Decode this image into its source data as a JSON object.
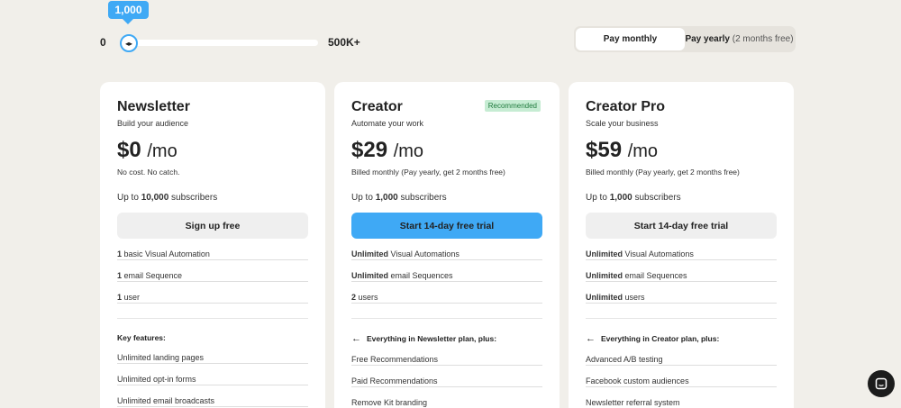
{
  "slider": {
    "tooltip": "1,000",
    "min_label": "0",
    "max_label": "500K+",
    "position_fraction": 0.0
  },
  "billing_toggle": {
    "monthly": "Pay monthly",
    "yearly": "Pay yearly",
    "yearly_note": "(2 months free)",
    "selected": "monthly"
  },
  "plans": [
    {
      "name": "Newsletter",
      "badge": "",
      "tagline": "Build your audience",
      "price": "$0",
      "per": "/mo",
      "note": "No cost. No catch.",
      "subs_prefix": "Up to ",
      "subs_count": "10,000",
      "subs_suffix": " subscribers",
      "cta": "Sign up free",
      "features": [
        {
          "bold": "1",
          "text": " basic Visual Automation"
        },
        {
          "bold": "1",
          "text": " email Sequence"
        },
        {
          "bold": "1",
          "text": " user"
        }
      ],
      "key_title": "Key features:",
      "key_features": [
        "Unlimited landing pages",
        "Unlimited opt-in forms",
        "Unlimited email broadcasts"
      ]
    },
    {
      "name": "Creator",
      "badge": "Recommended",
      "tagline": "Automate your work",
      "price": "$29",
      "per": "/mo",
      "note": "Billed monthly (Pay yearly, get 2 months free)",
      "subs_prefix": "Up to ",
      "subs_count": "1,000",
      "subs_suffix": " subscribers",
      "cta": "Start 14-day free trial",
      "features": [
        {
          "bold": "Unlimited",
          "text": " Visual Automations"
        },
        {
          "bold": "Unlimited",
          "text": " email Sequences"
        },
        {
          "bold": "2",
          "text": " users"
        }
      ],
      "key_title": "Everything in Newsletter plan, plus:",
      "key_features": [
        "Free Recommendations",
        "Paid Recommendations",
        "Remove Kit branding"
      ]
    },
    {
      "name": "Creator Pro",
      "badge": "",
      "tagline": "Scale your business",
      "price": "$59",
      "per": "/mo",
      "note": "Billed monthly (Pay yearly, get 2 months free)",
      "subs_prefix": "Up to ",
      "subs_count": "1,000",
      "subs_suffix": " subscribers",
      "cta": "Start 14-day free trial",
      "features": [
        {
          "bold": "Unlimited",
          "text": " Visual Automations"
        },
        {
          "bold": "Unlimited",
          "text": " email Sequences"
        },
        {
          "bold": "Unlimited",
          "text": " users"
        }
      ],
      "key_title": "Everything in Creator plan, plus:",
      "key_features": [
        "Advanced A/B testing",
        "Facebook custom audiences",
        "Newsletter referral system"
      ]
    }
  ],
  "colors": {
    "accent": "#3fa9f5",
    "background": "#f1efea",
    "badge_bg": "#c6ecd3",
    "badge_text": "#1f7a3d"
  },
  "chat": {
    "icon": "chat-icon"
  }
}
